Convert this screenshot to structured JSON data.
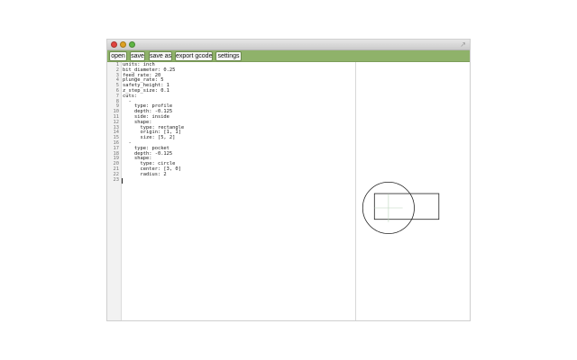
{
  "window": {
    "traffic_colors": [
      "#e0443e",
      "#dea123",
      "#5fb544"
    ],
    "expand_icon": "↗"
  },
  "toolbar": {
    "open_label": "open",
    "save_label": "save",
    "save_as_label": "save as",
    "export_gcode_label": "export gcode",
    "settings_label": "settings",
    "background": "#8fb26a"
  },
  "editor": {
    "lines": [
      "units: inch",
      "bit_diameter: 0.25",
      "feed_rate: 20",
      "plunge_rate: 5",
      "safety_height: 1",
      "z_step_size: 0.1",
      "cuts:",
      "  -",
      "    type: profile",
      "    depth: -0.125",
      "    side: inside",
      "    shape:",
      "      type: rectangle",
      "      origin: [1, 1]",
      "      size: [5, 2]",
      "  -",
      "    type: pocket",
      "    depth: -0.125",
      "    shape:",
      "      type: circle",
      "      center: [3, 0]",
      "      radius: 2",
      ""
    ],
    "line_numbers": [
      "1",
      "2",
      "3",
      "4",
      "5",
      "6",
      "7",
      "8",
      "9",
      "10",
      "11",
      "12",
      "13",
      "14",
      "15",
      "16",
      "17",
      "18",
      "19",
      "20",
      "21",
      "22",
      "23"
    ]
  },
  "preview": {
    "rectangle": {
      "origin": [
        1,
        1
      ],
      "size": [
        5,
        2
      ]
    },
    "circle": {
      "center": [
        3,
        0
      ],
      "radius": 2
    }
  }
}
